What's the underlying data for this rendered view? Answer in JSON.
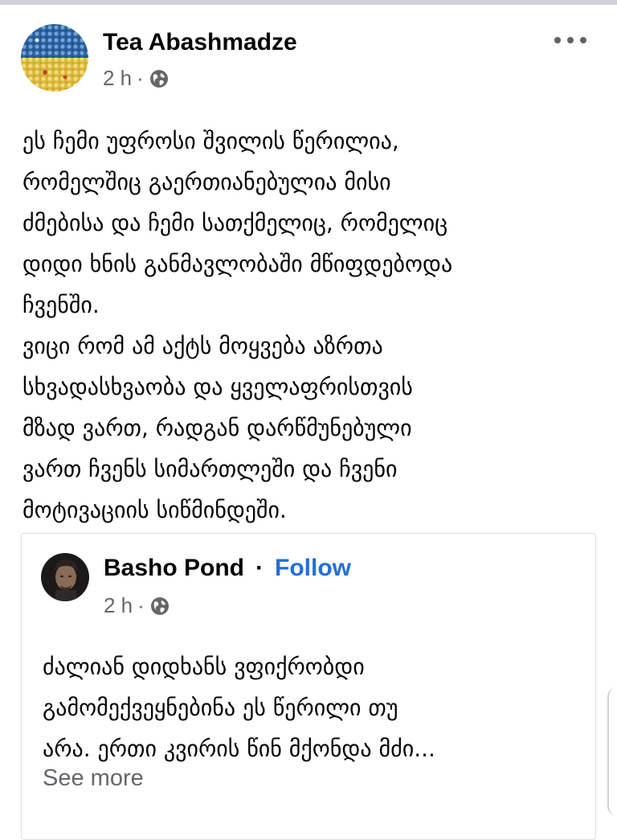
{
  "post": {
    "author": "Tea Abashmadze",
    "time": "2 h",
    "separator": "·",
    "privacy_icon": "globe-icon",
    "more_icon": "more-options-icon",
    "text_lines": [
      "ეს ჩემი უფროსი შვილის წერილია,",
      "რომელშიც გაერთიანებულია მისი",
      "ძმებისა და ჩემი სათქმელიც, რომელიც",
      "დიდი ხნის განმავლობაში მწიფდებოდა",
      "ჩვენში.",
      "ვიცი რომ ამ აქტს მოყვება აზრთა",
      "სხვადასხვაობა და ყველაფრისთვის",
      "მზად ვართ, რადგან დარწმუნებული",
      "ვართ ჩვენს სიმართლეში და ჩვენი",
      "მოტივაციის სიწმინდეში."
    ]
  },
  "shared": {
    "author": "Basho Pond",
    "separator": "·",
    "follow_label": "Follow",
    "time": "2 h",
    "meta_separator": "·",
    "privacy_icon": "globe-icon",
    "text_lines": [
      "ძალიან დიდხანს ვფიქრობდი",
      "გამომექვეყნებინა ეს წერილი თუ",
      "არა. ერთი კვირის წინ მქონდა მძი..."
    ],
    "see_more_label": "See more"
  },
  "colors": {
    "text": "#050505",
    "secondary_text": "#65676b",
    "link_blue": "#216fdb",
    "border": "#dcdee2"
  }
}
